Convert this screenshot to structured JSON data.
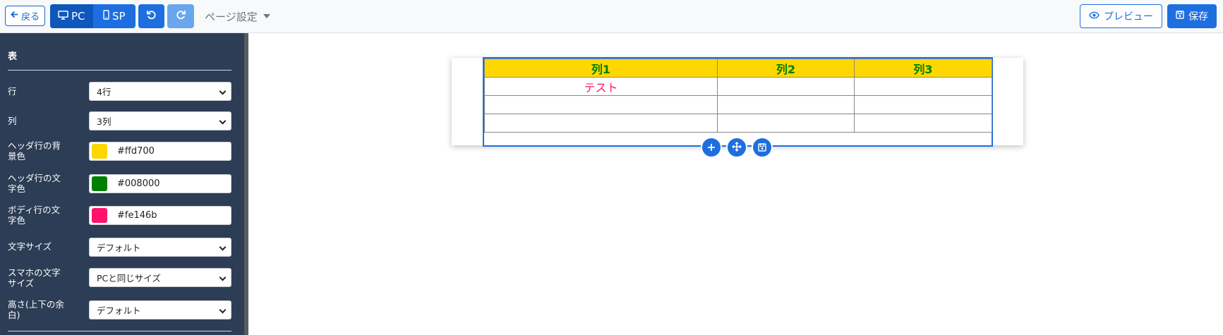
{
  "toolbar": {
    "back_label": "戻る",
    "device_pc_label": "PC",
    "device_sp_label": "SP",
    "page_settings_label": "ページ設定",
    "preview_label": "プレビュー",
    "save_label": "保存"
  },
  "sidebar": {
    "title": "表",
    "fields": [
      {
        "label": "行",
        "value": "4行"
      },
      {
        "label": "列",
        "value": "3列"
      },
      {
        "label": "ヘッダ行の背景色",
        "value": "#ffd700"
      },
      {
        "label": "ヘッダ行の文字色",
        "value": "#008000"
      },
      {
        "label": "ボディ行の文字色",
        "value": "#fe146b"
      },
      {
        "label": "文字サイズ",
        "value": "デフォルト"
      },
      {
        "label": "スマホの文字サイズ",
        "value": "PCと同じサイズ"
      },
      {
        "label": "高さ(上下の余白)",
        "value": "デフォルト"
      }
    ]
  },
  "table": {
    "header_bg": "#ffd700",
    "header_color": "#008000",
    "body_color": "#fe146b",
    "headers": [
      "列1",
      "列2",
      "列3"
    ],
    "rows": [
      [
        "テスト",
        "",
        ""
      ],
      [
        "",
        "",
        ""
      ],
      [
        "",
        "",
        ""
      ]
    ]
  },
  "colors": {
    "accent": "#1d6fe0",
    "sidebar_bg": "#2c3d55"
  }
}
